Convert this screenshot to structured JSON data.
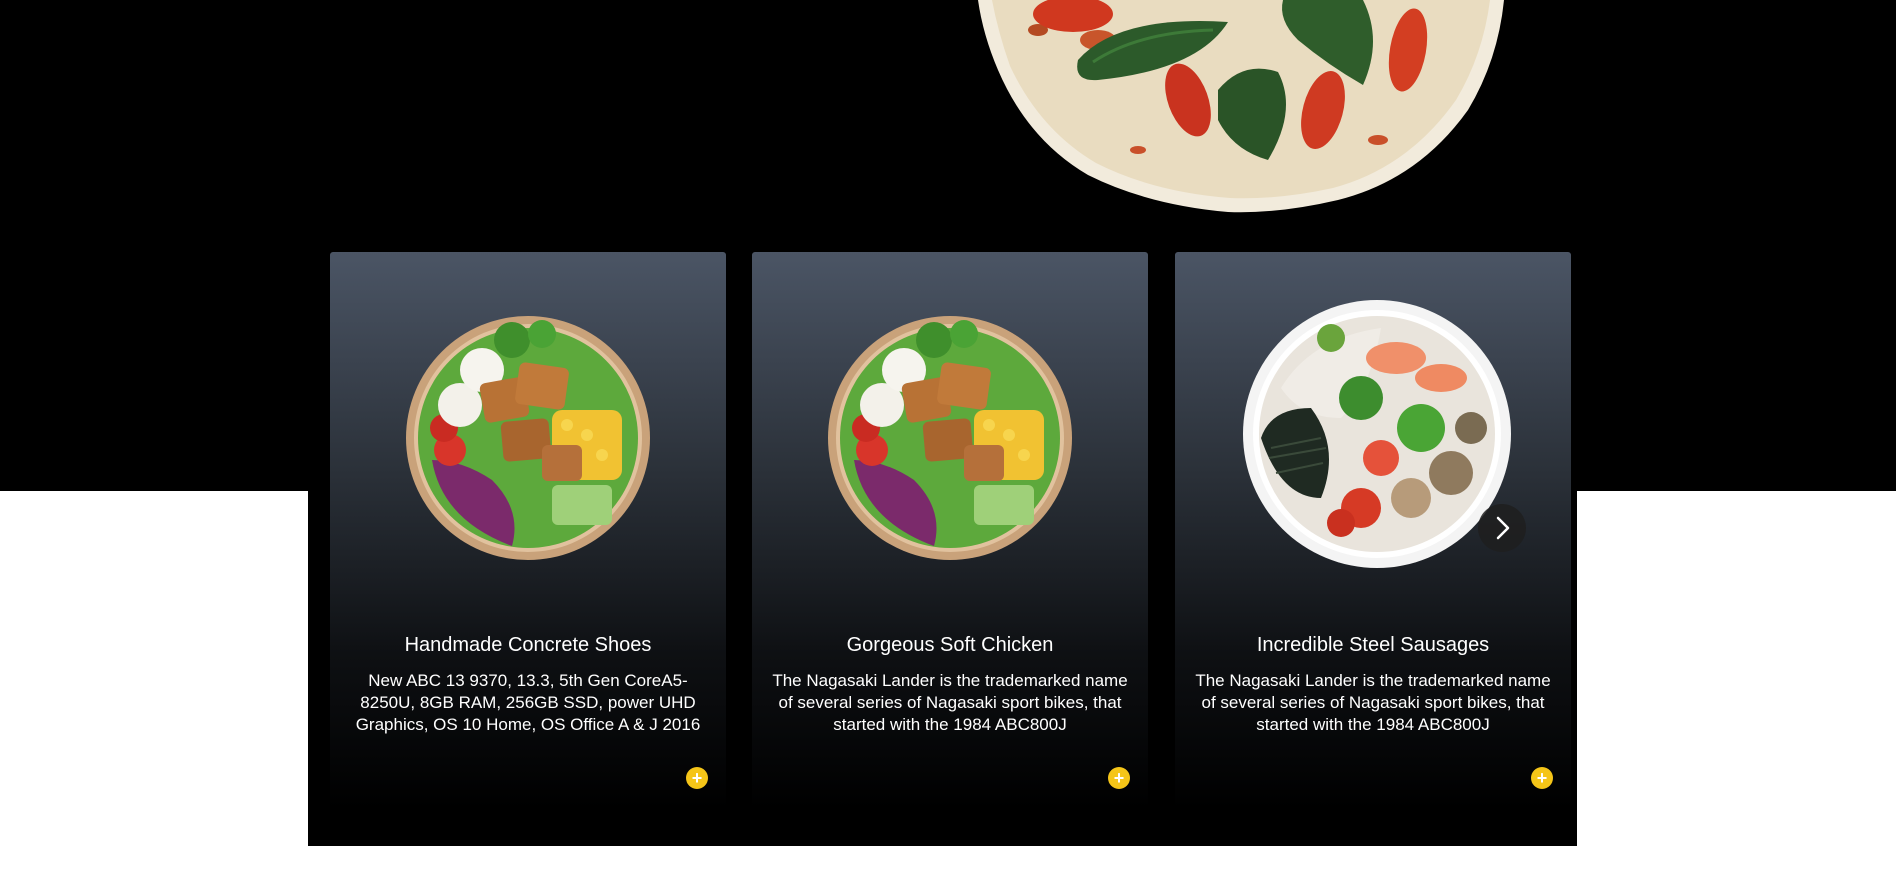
{
  "colors": {
    "background": "#ffffff",
    "hero_band": "#000000",
    "card_top": "#4b5565",
    "card_bottom": "#000000",
    "accent": "#f5c518",
    "text": "#ffffff"
  },
  "hero": {
    "image": "pizza-margherita-image"
  },
  "carousel": {
    "next_icon": "chevron-right-icon",
    "cards": [
      {
        "image": "salad-bowl-image",
        "title": "Handmade Concrete Shoes",
        "description": "New ABC 13 9370, 13.3, 5th Gen CoreA5-8250U, 8GB RAM, 256GB SSD, power UHD Graphics, OS 10 Home, OS Office A & J 2016",
        "add_icon": "plus-icon",
        "add_label": "+"
      },
      {
        "image": "salad-bowl-image",
        "title": "Gorgeous Soft Chicken",
        "description": "The Nagasaki Lander is the trademarked name of several series of Nagasaki sport bikes, that started with the 1984 ABC800J",
        "add_icon": "plus-icon",
        "add_label": "+"
      },
      {
        "image": "noodle-bowl-image",
        "title": "Incredible Steel Sausages",
        "description": "The Nagasaki Lander is the trademarked name of several series of Nagasaki sport bikes, that started with the 1984 ABC800J",
        "add_icon": "plus-icon",
        "add_label": "+"
      }
    ]
  }
}
